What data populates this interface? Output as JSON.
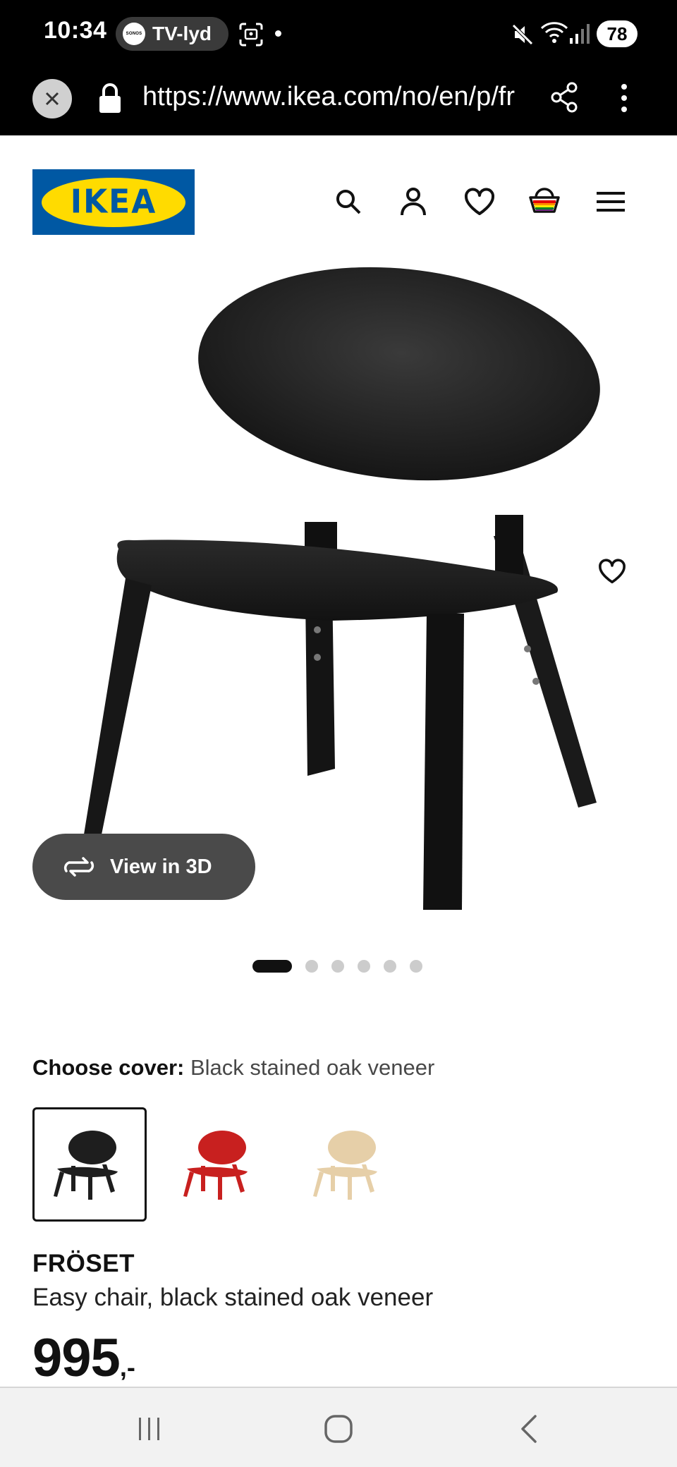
{
  "status_bar": {
    "time": "10:34",
    "sonos_logo_text": "SONOS",
    "media_label": "TV-lyd",
    "battery": "78",
    "icons": [
      "screen-cast-icon",
      "mute-icon",
      "wifi-icon",
      "signal-icon"
    ]
  },
  "browser": {
    "url": "https://www.ikea.com/no/en/p/fr",
    "icons": [
      "close-icon",
      "lock-icon",
      "share-icon",
      "kebab-menu-icon"
    ]
  },
  "header": {
    "logo_text": "IKEA",
    "colors": {
      "brand_blue": "#0058a3",
      "brand_yellow": "#ffdb00"
    },
    "icons": [
      "search-icon",
      "profile-icon",
      "heart-icon",
      "shopping-bag-icon",
      "hamburger-menu-icon"
    ]
  },
  "gallery": {
    "view_3d_label": "View in 3D",
    "image_count": 6,
    "active_index": 0
  },
  "cover": {
    "label": "Choose cover:",
    "selected": "Black stained oak veneer",
    "options": [
      {
        "color": "#1e1e1e",
        "selected": true
      },
      {
        "color": "#c8201f",
        "selected": false
      },
      {
        "color": "#e6cfa8",
        "selected": false
      }
    ]
  },
  "product": {
    "name": "FRÖSET",
    "description": "Easy chair, black stained oak veneer",
    "price_integer": "995",
    "price_suffix": ",-"
  }
}
